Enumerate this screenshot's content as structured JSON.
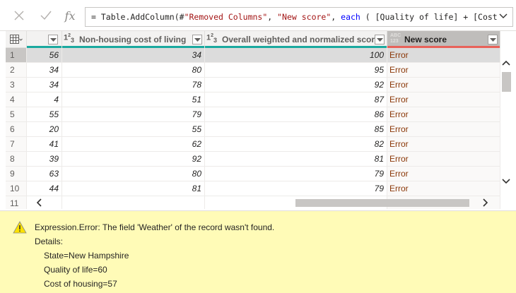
{
  "formula": {
    "cancel_icon": "close-icon",
    "commit_icon": "check-icon",
    "fx_label": "fx",
    "parts": [
      {
        "text": "= Table.AddColumn(#",
        "kind": "plain"
      },
      {
        "text": "\"Removed Columns\"",
        "kind": "str"
      },
      {
        "text": ", ",
        "kind": "plain"
      },
      {
        "text": "\"New score\"",
        "kind": "str"
      },
      {
        "text": ", ",
        "kind": "plain"
      },
      {
        "text": "each",
        "kind": "kw"
      },
      {
        "text": " ( [Quality of life] + [Cost",
        "kind": "plain"
      }
    ]
  },
  "table": {
    "columns": [
      {
        "label": "",
        "type": ""
      },
      {
        "label": "Non-housing cost of living",
        "type": "123"
      },
      {
        "label": "Overall weighted and normalized score",
        "type": "123"
      },
      {
        "label": "New score",
        "type": "ABC"
      }
    ],
    "rows": [
      [
        "1",
        "56",
        "34",
        "100",
        "Error"
      ],
      [
        "2",
        "34",
        "80",
        "95",
        "Error"
      ],
      [
        "3",
        "34",
        "78",
        "92",
        "Error"
      ],
      [
        "4",
        "4",
        "51",
        "87",
        "Error"
      ],
      [
        "5",
        "55",
        "79",
        "86",
        "Error"
      ],
      [
        "6",
        "20",
        "55",
        "85",
        "Error"
      ],
      [
        "7",
        "41",
        "62",
        "82",
        "Error"
      ],
      [
        "8",
        "39",
        "92",
        "81",
        "Error"
      ],
      [
        "9",
        "63",
        "80",
        "79",
        "Error"
      ],
      [
        "10",
        "44",
        "81",
        "79",
        "Error"
      ],
      [
        "11",
        "",
        "",
        "",
        ""
      ]
    ],
    "selected_row": 0
  },
  "error": {
    "icon": "warning-icon",
    "message": "Expression.Error: The field 'Weather' of the record wasn't found.",
    "details_label": "Details:",
    "details": [
      "State=New Hampshire",
      "Quality of life=60",
      "Cost of housing=57"
    ]
  },
  "colors": {
    "quality_ok": "#1aa99f",
    "quality_error": "#e8625a",
    "error_bg": "#fffbb7",
    "error_text": "#8a3707"
  }
}
